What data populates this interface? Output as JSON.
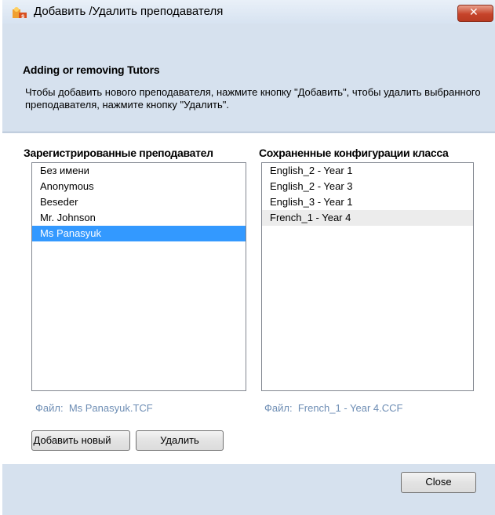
{
  "window": {
    "title": "Добавить /Удалить преподавателя",
    "close_symbol": "✕"
  },
  "header": {
    "title": "Adding or removing Tutors",
    "description": "Чтобы добавить нового преподавателя, нажмите кнопку \"Добавить\", чтобы удалить выбранного преподавателя, нажмите кнопку \"Удалить\"."
  },
  "tutors": {
    "heading": "Зарегистрированные преподавател",
    "items": [
      "Без имени",
      "Anonymous",
      "Beseder",
      "Mr. Johnson",
      "Ms Panasyuk"
    ],
    "selected": "Ms Panasyuk",
    "file_label": "Файл:",
    "file_value": "Ms Panasyuk.TCF"
  },
  "configs": {
    "heading": "Сохраненные конфигурации класса",
    "items": [
      "English_2 - Year 1",
      "English_2 - Year 3",
      "English_3 - Year 1",
      "French_1 - Year 4"
    ],
    "selected": "French_1 - Year 4",
    "file_label": "Файл:",
    "file_value": "French_1 - Year 4.CCF"
  },
  "buttons": {
    "add": "Добавить новый",
    "delete": "Удалить",
    "close": "Close"
  },
  "colors": {
    "selection": "#3399ff",
    "file_text": "#6d8db4",
    "panel": "#d6e1ee"
  }
}
